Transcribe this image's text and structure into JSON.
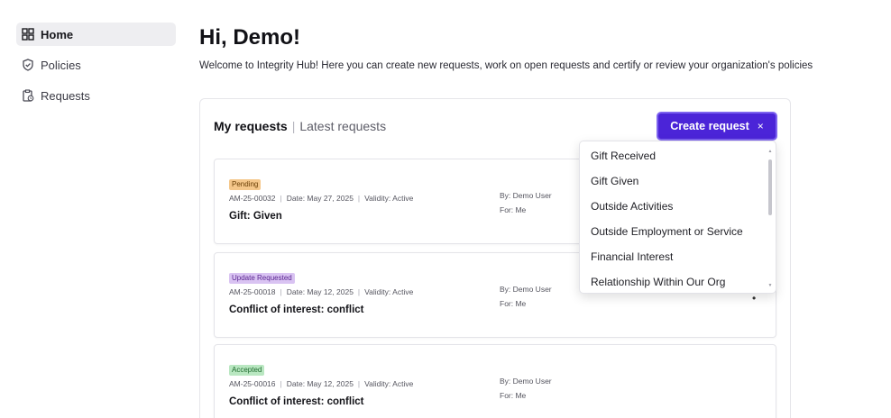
{
  "sidebar": {
    "items": [
      {
        "label": "Home",
        "icon": "dashboard-icon"
      },
      {
        "label": "Policies",
        "icon": "shield-check-icon"
      },
      {
        "label": "Requests",
        "icon": "clipboard-icon"
      }
    ]
  },
  "main": {
    "title": "Hi, Demo!",
    "welcome": "Welcome to Integrity Hub! Here you can create new requests, work on open requests and certify or review your organization's policies"
  },
  "requests_panel": {
    "tab_active": "My requests",
    "tab_separator": "|",
    "tab_inactive": "Latest requests",
    "create_label": "Create request",
    "create_close": "×"
  },
  "requests": [
    {
      "status": "Pending",
      "id": "AM-25-00032",
      "date": "Date: May 27, 2025",
      "validity": "Validity: Active",
      "title": "Gift: Given",
      "by": "By: Demo User",
      "for": "For: Me"
    },
    {
      "status": "Update Requested",
      "id": "AM-25-00018",
      "date": "Date: May 12, 2025",
      "validity": "Validity: Active",
      "title": "Conflict of interest: conflict",
      "by": "By: Demo User",
      "for": "For: Me"
    },
    {
      "status": "Accepted",
      "id": "AM-25-00016",
      "date": "Date: May 12, 2025",
      "validity": "Validity: Active",
      "title": "Conflict of interest: conflict",
      "by": "By: Demo User",
      "for": "For: Me"
    }
  ],
  "create_menu": {
    "options": [
      "Gift Received",
      "Gift Given",
      "Outside Activities",
      "Outside Employment or Service",
      "Financial Interest",
      "Relationship Within Our Org"
    ]
  },
  "colors": {
    "accent": "#4b24d8",
    "pending": "#f5c78a",
    "update_requested": "#d9c3f2",
    "accepted": "#b9e7c1"
  }
}
